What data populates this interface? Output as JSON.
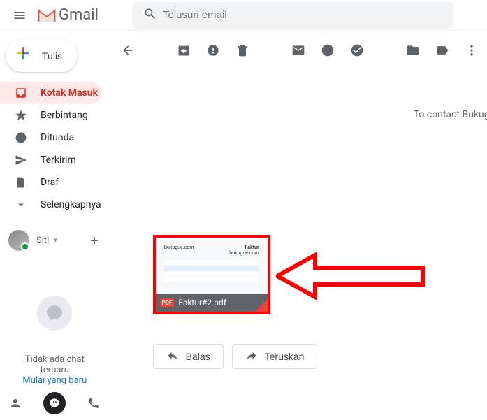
{
  "header": {
    "logo_text": "Gmail",
    "search_placeholder": "Telusuri email"
  },
  "compose": {
    "label": "Tulis"
  },
  "nav": {
    "items": [
      {
        "label": "Kotak Masuk"
      },
      {
        "label": "Berbintang"
      },
      {
        "label": "Ditunda"
      },
      {
        "label": "Terkirim"
      },
      {
        "label": "Draf"
      },
      {
        "label": "Selengkapnya"
      }
    ]
  },
  "chat": {
    "user_name": "Siti",
    "empty_text": "Tidak ada chat terbaru",
    "start_link": "Mulai yang baru"
  },
  "message": {
    "contact_note": "To contact Bukug",
    "attachment": {
      "filename": "Faktur#2.pdf",
      "badge": "PDF",
      "preview": {
        "site": "Bukugue.com",
        "title": "Faktur",
        "sub": "bukugue.com"
      }
    },
    "actions": {
      "reply": "Balas",
      "forward": "Teruskan"
    }
  }
}
